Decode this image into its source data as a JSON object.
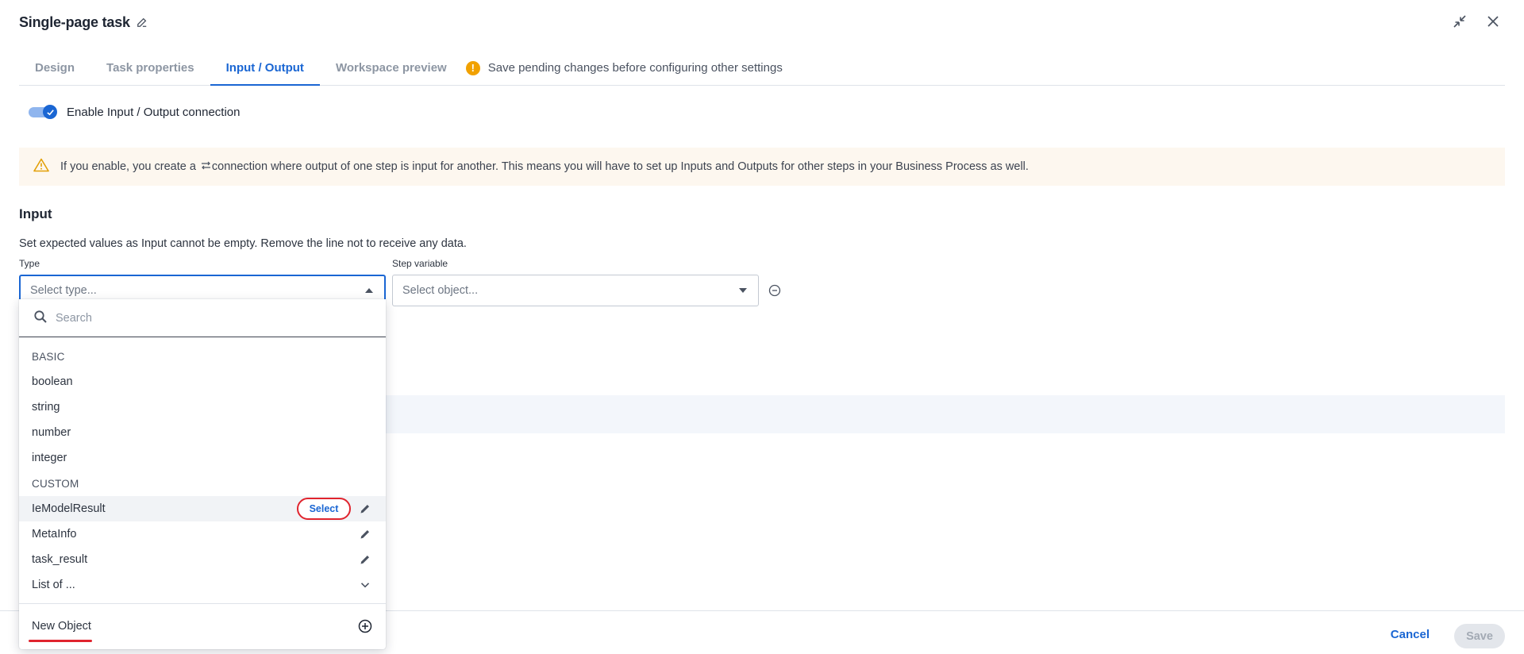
{
  "header": {
    "title": "Single-page task"
  },
  "tabs": [
    {
      "label": "Design"
    },
    {
      "label": "Task properties"
    },
    {
      "label": "Input / Output"
    },
    {
      "label": "Workspace preview"
    }
  ],
  "tab_warning": {
    "text": "Save pending changes before configuring other settings"
  },
  "toggle": {
    "label": "Enable Input / Output connection",
    "checked": true
  },
  "alert": {
    "text_before": "If you enable, you create a ",
    "text_after": "connection where output of one step is input for another. This means you will have to set up Inputs and Outputs for other steps in your Business Process as well."
  },
  "input_section": {
    "title": "Input",
    "description": "Set expected values as Input cannot be empty. Remove the line not to receive any data.",
    "type_label": "Type",
    "type_placeholder": "Select type...",
    "variable_label": "Step variable",
    "variable_placeholder": "Select object..."
  },
  "dropdown": {
    "search_placeholder": "Search",
    "basic_group": "BASIC",
    "basic_items": [
      {
        "label": "boolean"
      },
      {
        "label": "string"
      },
      {
        "label": "number"
      },
      {
        "label": "integer"
      }
    ],
    "custom_group": "CUSTOM",
    "custom_items": [
      {
        "label": "IeModelResult",
        "select_label": "Select"
      },
      {
        "label": "MetaInfo"
      },
      {
        "label": "task_result"
      }
    ],
    "list_item": {
      "label": "List of ..."
    },
    "new_object": {
      "label": "New Object"
    }
  },
  "footer": {
    "cancel_label": "Cancel",
    "save_label": "Save"
  },
  "colors": {
    "accent": "#1a66d3",
    "warning": "#f1a100",
    "highlight": "#e0242e"
  }
}
